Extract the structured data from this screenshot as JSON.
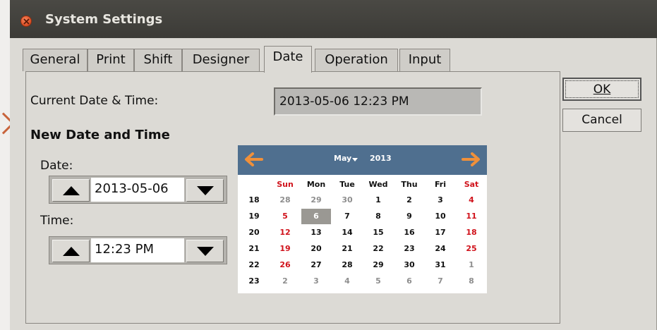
{
  "window": {
    "title": "System Settings"
  },
  "tabs": [
    {
      "label": "General"
    },
    {
      "label": "Print"
    },
    {
      "label": "Shift"
    },
    {
      "label": "Designer"
    },
    {
      "label": "Date",
      "active": true
    },
    {
      "label": "Operation"
    },
    {
      "label": "Input"
    }
  ],
  "date_tab": {
    "current_label": "Current Date & Time:",
    "current_value": "2013-05-06 12:23 PM",
    "new_section_title": "New Date and Time",
    "date_label": "Date:",
    "date_value": "2013-05-06",
    "time_label": "Time:",
    "time_value": "12:23 PM"
  },
  "calendar": {
    "month": "May",
    "year": "2013",
    "weekday_headers": [
      "Sun",
      "Mon",
      "Tue",
      "Wed",
      "Thu",
      "Fri",
      "Sat"
    ],
    "weeks": [
      {
        "week_number": "18",
        "days": [
          "28",
          "29",
          "30",
          "1",
          "2",
          "3",
          "4"
        ]
      },
      {
        "week_number": "19",
        "days": [
          "5",
          "6",
          "7",
          "8",
          "9",
          "10",
          "11"
        ]
      },
      {
        "week_number": "20",
        "days": [
          "12",
          "13",
          "14",
          "15",
          "16",
          "17",
          "18"
        ]
      },
      {
        "week_number": "21",
        "days": [
          "19",
          "20",
          "21",
          "22",
          "23",
          "24",
          "25"
        ]
      },
      {
        "week_number": "22",
        "days": [
          "26",
          "27",
          "28",
          "29",
          "30",
          "31",
          "1"
        ]
      },
      {
        "week_number": "23",
        "days": [
          "2",
          "3",
          "4",
          "5",
          "6",
          "7",
          "8"
        ]
      }
    ],
    "selected_day": "6",
    "header_color": "#4f6f8f",
    "arrow_color": "#f0903a",
    "weekend_color": "#d0121b",
    "other_month_color": "#8e8e8e"
  },
  "buttons": {
    "ok_label": "OK",
    "cancel_label": "Cancel"
  }
}
